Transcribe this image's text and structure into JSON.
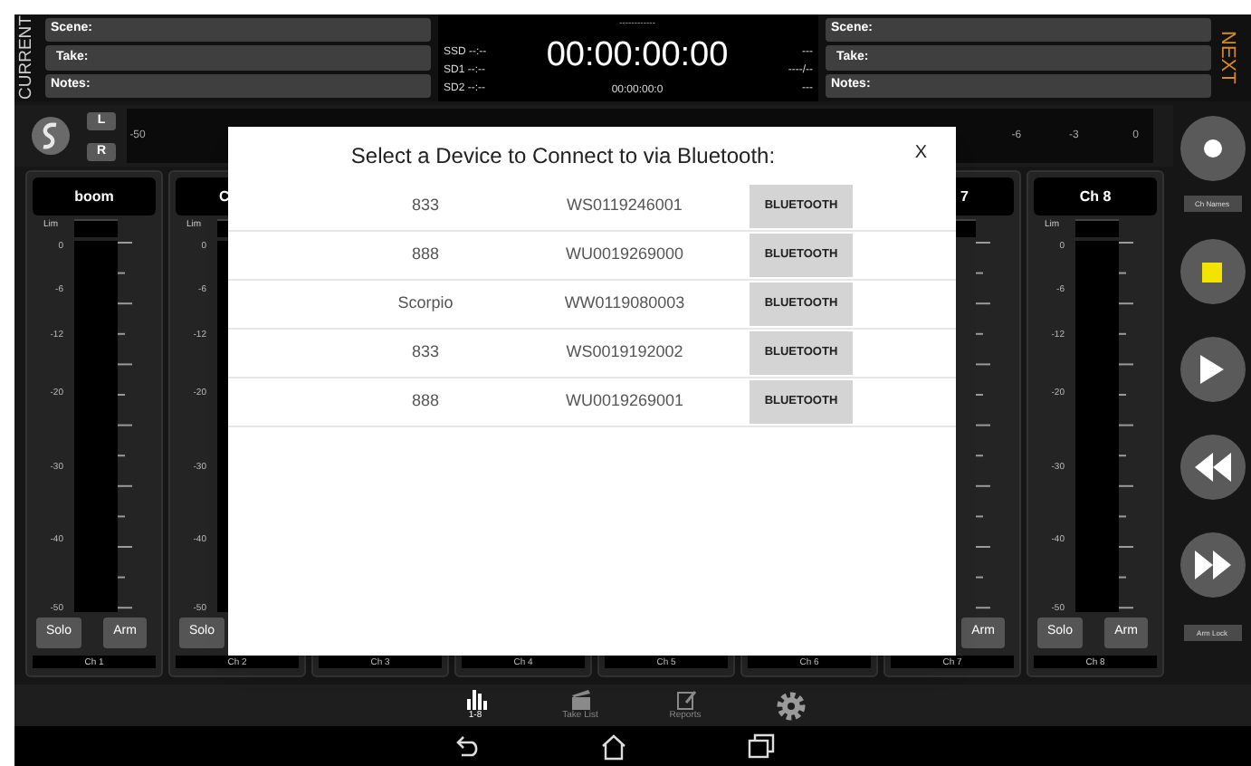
{
  "current": {
    "label": "CURRENT",
    "fields": [
      {
        "label": "Scene:"
      },
      {
        "label": "Take:"
      },
      {
        "label": "Notes:"
      }
    ]
  },
  "timecode": {
    "top": "------------",
    "left": [
      "SSD --:--",
      "SD1 --:--",
      "SD2 --:--"
    ],
    "main": "00:00:00:00",
    "sub": "00:00:00:0",
    "right": [
      "---",
      "----/--",
      "---"
    ]
  },
  "next": {
    "label": "NEXT",
    "fields": [
      {
        "label": "Scene:"
      },
      {
        "label": "Take:"
      },
      {
        "label": "Notes:"
      }
    ]
  },
  "meter": {
    "channels": [
      "L",
      "R"
    ],
    "scale": [
      "-50",
      "-6",
      "-3",
      "0"
    ]
  },
  "strips": [
    {
      "kind": "full",
      "name": "boom",
      "lim": "Lim",
      "scale": [
        "0",
        "-6",
        "-12",
        "-20",
        "-30",
        "-40",
        "-50"
      ],
      "solo": "Solo",
      "arm": "Arm",
      "label": "Ch 1"
    },
    {
      "kind": "left",
      "name": "C",
      "lim": "Lim",
      "scale": [
        "0",
        "-6",
        "-12",
        "-20",
        "-30",
        "-40",
        "-50"
      ],
      "solo": "Solo",
      "label": "Ch 2"
    },
    {
      "kind": "covered",
      "label": "Ch 3"
    },
    {
      "kind": "covered",
      "label": "Ch 4"
    },
    {
      "kind": "covered",
      "label": "Ch 5"
    },
    {
      "kind": "covered",
      "label": "Ch 6"
    },
    {
      "kind": "right",
      "name": "7",
      "arm": "Arm",
      "label": "Ch 7"
    },
    {
      "kind": "full",
      "name": "Ch 8",
      "lim": "Lim",
      "scale": [
        "0",
        "-6",
        "-12",
        "-20",
        "-30",
        "-40",
        "-50"
      ],
      "solo": "Solo",
      "arm": "Arm",
      "label": "Ch 8"
    }
  ],
  "transport": [
    {
      "kind": "record"
    },
    {
      "kind": "text",
      "label": "Ch Names"
    },
    {
      "kind": "stop"
    },
    {
      "kind": "play"
    },
    {
      "kind": "rewind"
    },
    {
      "kind": "forward"
    },
    {
      "kind": "text",
      "label": "Arm Lock"
    }
  ],
  "tabs": [
    {
      "kind": "meters",
      "label": "1-8",
      "selected": true
    },
    {
      "kind": "clapper",
      "label": "Take List",
      "selected": false
    },
    {
      "kind": "edit",
      "label": "Reports",
      "selected": false
    },
    {
      "kind": "settings",
      "selected": false
    }
  ],
  "dialog": {
    "title": "Select a Device to Connect to via Bluetooth:",
    "close": "X",
    "devices": [
      {
        "name": "833",
        "serial": "WS0119246001",
        "button": "BLUETOOTH"
      },
      {
        "name": "888",
        "serial": "WU0019269000",
        "button": "BLUETOOTH"
      },
      {
        "name": "Scorpio",
        "serial": "WW0119080003",
        "button": "BLUETOOTH"
      },
      {
        "name": "833",
        "serial": "WS0019192002",
        "button": "BLUETOOTH"
      },
      {
        "name": "888",
        "serial": "WU0019269001",
        "button": "BLUETOOTH"
      }
    ]
  }
}
